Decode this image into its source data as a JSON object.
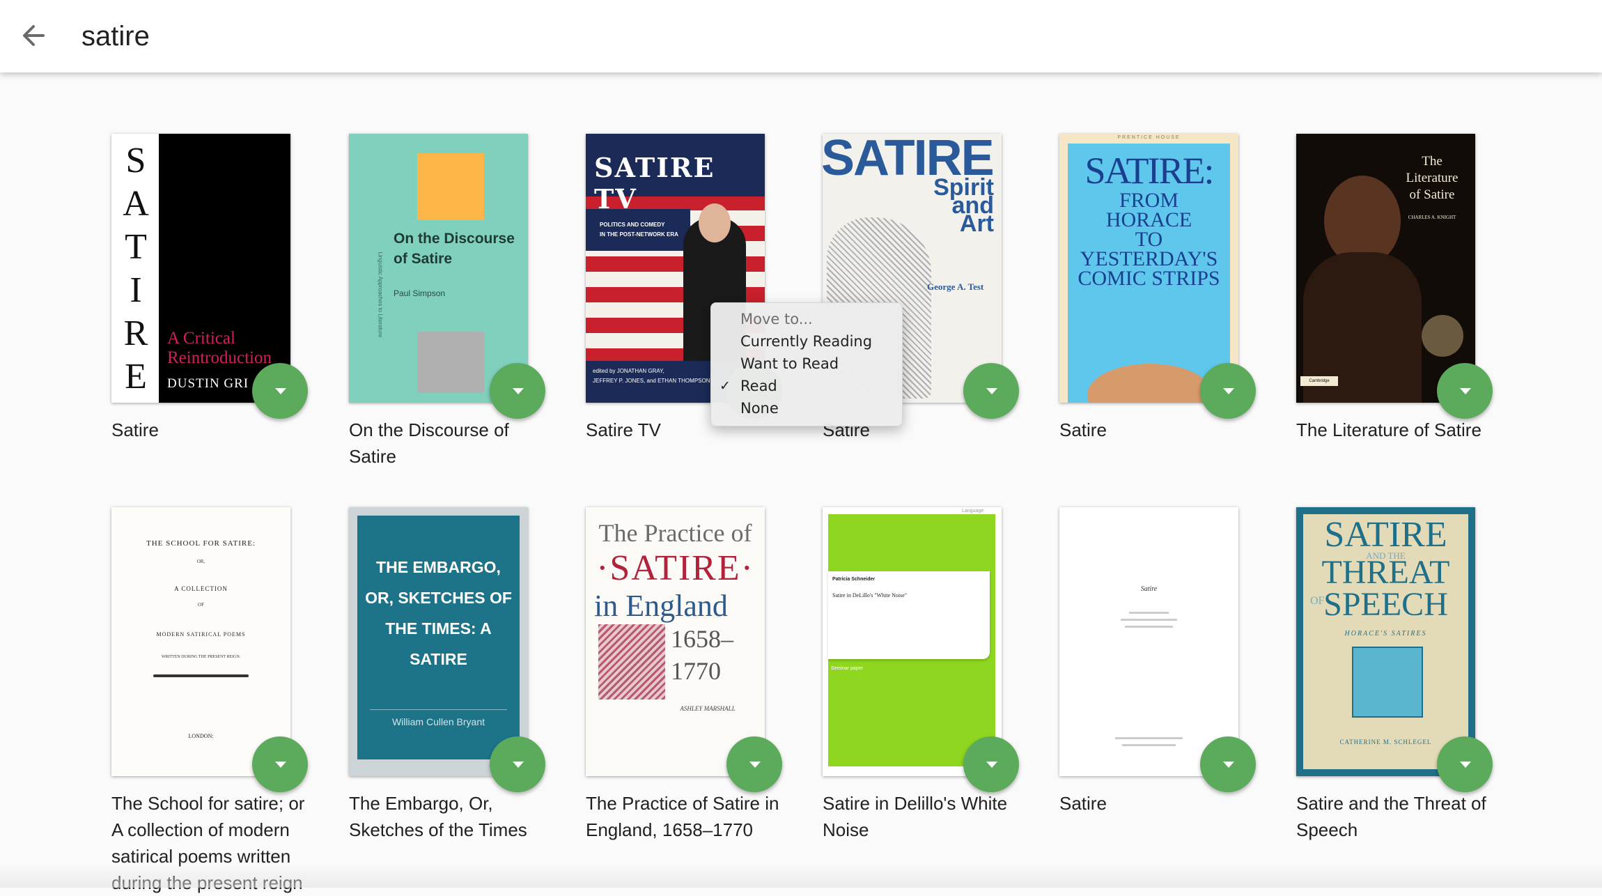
{
  "header": {
    "query": "satire"
  },
  "books": [
    {
      "title": "Satire",
      "cover": {
        "letters": "S\nA\nT\nI\nR\nE",
        "subtitle": "A Critical\nReintroduction",
        "author": "DUSTIN GRI"
      }
    },
    {
      "title": "On the Discourse of Satire",
      "cover": {
        "title": "On the Discourse\nof Satire",
        "author": "Paul Simpson",
        "series": "Linguistic Approaches to Literature"
      }
    },
    {
      "title": "Satire TV",
      "cover": {
        "title": "SATIRE TV",
        "subtitle": "POLITICS AND COMEDY\nIN THE POST-NETWORK ERA",
        "editors": "edited by JONATHAN GRAY,\nJEFFREY P. JONES, and ETHAN THOMPSON"
      }
    },
    {
      "title": "Satire",
      "cover": {
        "title": "SATIRE",
        "subtitle": "Spirit\nand\nArt",
        "author": "George A. Test"
      }
    },
    {
      "title": "Satire",
      "cover": {
        "publisher": "PRENTICE HOUSE",
        "title": "SATIRE:",
        "subtitle": "FROM\nHORACE\nTO\nYESTERDAY'S\nCOMIC STRIPS"
      }
    },
    {
      "title": "The Literature of Satire",
      "cover": {
        "title": "The\nLiterature\nof Satire",
        "author": "CHARLES A. KNIGHT",
        "publisher": "Cambridge"
      }
    },
    {
      "title": "The School for satire; or A collection of modern satirical poems written during the present reign",
      "cover": {
        "title": "THE SCHOOL FOR SATIRE:",
        "line2": "OR,",
        "line3": "A COLLECTION",
        "line4": "OF",
        "line5": "MODERN SATIRICAL POEMS",
        "line6": "WRITTEN DURING THE PRESENT REIGN.",
        "imprint": "LONDON:"
      }
    },
    {
      "title": "The Embargo, Or, Sketches of the Times",
      "cover": {
        "title": "THE EMBARGO,\nOR, SKETCHES OF\nTHE TIMES: A\nSATIRE",
        "author": "William Cullen Bryant"
      }
    },
    {
      "title": "The Practice of Satire in England, 1658–1770",
      "cover": {
        "line1": "The Practice of",
        "line2": "·SATIRE·",
        "line3": "in England",
        "years": "1658–\n1770",
        "author": "ASHLEY MARSHALL"
      }
    },
    {
      "title": "Satire in Delillo's White Noise",
      "cover": {
        "author": "Patricia Schneider",
        "title": "Satire in DeLillo's \"White Noise\"",
        "label": "Seminar paper",
        "tag": "Language"
      }
    },
    {
      "title": "Satire",
      "cover": {
        "title": "Satire"
      }
    },
    {
      "title": "Satire and the Threat of Speech",
      "cover": {
        "line1": "SATIRE",
        "line2": "AND THE",
        "line3": "THREAT",
        "line4": "OF",
        "line5": "SPEECH",
        "subtitle": "HORACE'S SATIRES",
        "author": "CATHERINE M. SCHLEGEL"
      }
    }
  ],
  "context_menu": {
    "header": "Move to...",
    "items": [
      {
        "label": "Currently Reading",
        "checked": false
      },
      {
        "label": "Want to Read",
        "checked": false
      },
      {
        "label": "Read",
        "checked": true
      },
      {
        "label": "None",
        "checked": false
      }
    ],
    "check_glyph": "✓"
  },
  "colors": {
    "fab": "#5caa5c",
    "teal_cover": "#7fd0bd",
    "green_cover": "#8ed61f",
    "embargo_cover": "#1d7388"
  }
}
